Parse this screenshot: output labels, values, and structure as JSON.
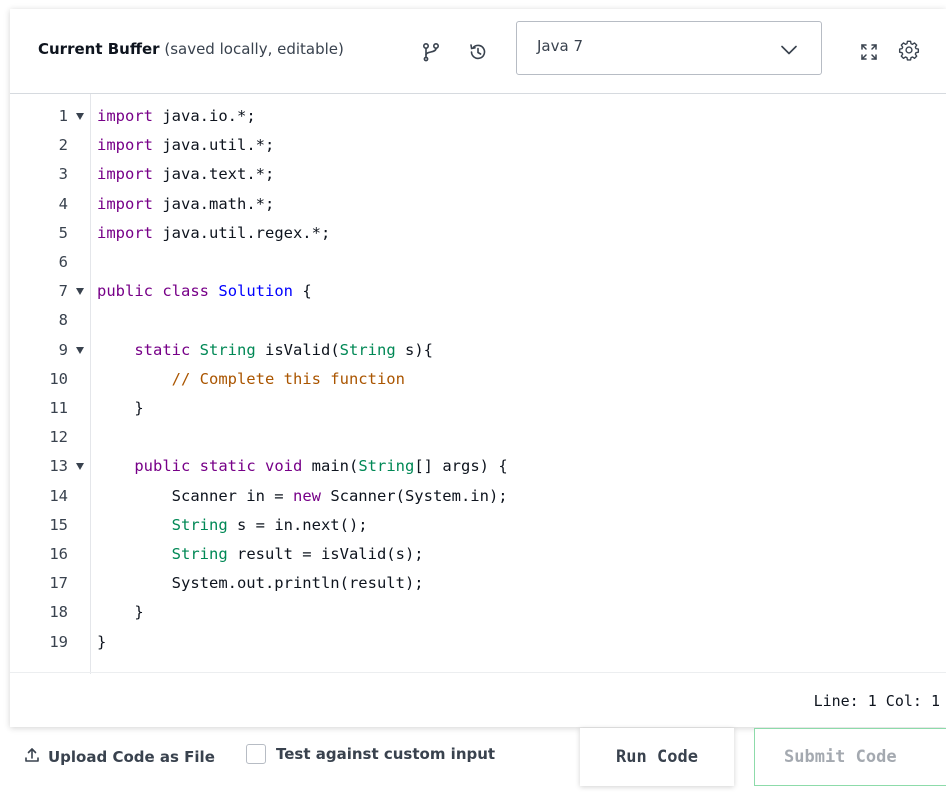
{
  "header": {
    "title_bold": "Current Buffer",
    "title_note": "(saved locally, editable)",
    "icons": [
      "branch-icon",
      "history-icon",
      "expand-icon",
      "settings-icon"
    ]
  },
  "language_select": {
    "value": "Java 7",
    "icon": "chevron-down-icon"
  },
  "editor": {
    "lines": [
      {
        "num": "1",
        "fold": true,
        "indent": "",
        "tokens": [
          {
            "t": "import",
            "c": "kw"
          },
          {
            "t": " java.io.*;",
            "c": ""
          }
        ]
      },
      {
        "num": "2",
        "fold": false,
        "indent": "",
        "tokens": [
          {
            "t": "import",
            "c": "kw"
          },
          {
            "t": " java.util.*;",
            "c": ""
          }
        ]
      },
      {
        "num": "3",
        "fold": false,
        "indent": "",
        "tokens": [
          {
            "t": "import",
            "c": "kw"
          },
          {
            "t": " java.text.*;",
            "c": ""
          }
        ]
      },
      {
        "num": "4",
        "fold": false,
        "indent": "",
        "tokens": [
          {
            "t": "import",
            "c": "kw"
          },
          {
            "t": " java.math.*;",
            "c": ""
          }
        ]
      },
      {
        "num": "5",
        "fold": false,
        "indent": "",
        "tokens": [
          {
            "t": "import",
            "c": "kw"
          },
          {
            "t": " java.util.regex.*;",
            "c": ""
          }
        ]
      },
      {
        "num": "6",
        "fold": false,
        "indent": "",
        "tokens": []
      },
      {
        "num": "7",
        "fold": true,
        "indent": "",
        "tokens": [
          {
            "t": "public",
            "c": "kw"
          },
          {
            "t": " ",
            "c": ""
          },
          {
            "t": "class",
            "c": "kw"
          },
          {
            "t": " ",
            "c": ""
          },
          {
            "t": "Solution",
            "c": "def"
          },
          {
            "t": " {",
            "c": ""
          }
        ]
      },
      {
        "num": "8",
        "fold": false,
        "indent": "",
        "tokens": []
      },
      {
        "num": "9",
        "fold": true,
        "indent": "    ",
        "tokens": [
          {
            "t": "static",
            "c": "kw"
          },
          {
            "t": " ",
            "c": ""
          },
          {
            "t": "String",
            "c": "typ"
          },
          {
            "t": " isValid(",
            "c": ""
          },
          {
            "t": "String",
            "c": "typ"
          },
          {
            "t": " s){",
            "c": ""
          }
        ]
      },
      {
        "num": "10",
        "fold": false,
        "indent": "        ",
        "tokens": [
          {
            "t": "// Complete this function",
            "c": "cmt"
          }
        ]
      },
      {
        "num": "11",
        "fold": false,
        "indent": "    ",
        "tokens": [
          {
            "t": "}",
            "c": ""
          }
        ]
      },
      {
        "num": "12",
        "fold": false,
        "indent": "",
        "tokens": []
      },
      {
        "num": "13",
        "fold": true,
        "indent": "    ",
        "tokens": [
          {
            "t": "public",
            "c": "kw"
          },
          {
            "t": " ",
            "c": ""
          },
          {
            "t": "static",
            "c": "kw"
          },
          {
            "t": " ",
            "c": ""
          },
          {
            "t": "void",
            "c": "kw"
          },
          {
            "t": " main(",
            "c": ""
          },
          {
            "t": "String",
            "c": "typ"
          },
          {
            "t": "[] args) {",
            "c": ""
          }
        ]
      },
      {
        "num": "14",
        "fold": false,
        "indent": "        ",
        "tokens": [
          {
            "t": "Scanner in = ",
            "c": ""
          },
          {
            "t": "new",
            "c": "kw"
          },
          {
            "t": " Scanner(System.in);",
            "c": ""
          }
        ]
      },
      {
        "num": "15",
        "fold": false,
        "indent": "        ",
        "tokens": [
          {
            "t": "String",
            "c": "typ"
          },
          {
            "t": " s = in.next();",
            "c": ""
          }
        ]
      },
      {
        "num": "16",
        "fold": false,
        "indent": "        ",
        "tokens": [
          {
            "t": "String",
            "c": "typ"
          },
          {
            "t": " result = isValid(s);",
            "c": ""
          }
        ]
      },
      {
        "num": "17",
        "fold": false,
        "indent": "        ",
        "tokens": [
          {
            "t": "System.out.println(result);",
            "c": ""
          }
        ]
      },
      {
        "num": "18",
        "fold": false,
        "indent": "    ",
        "tokens": [
          {
            "t": "}",
            "c": ""
          }
        ]
      },
      {
        "num": "19",
        "fold": false,
        "indent": "",
        "tokens": [
          {
            "t": "}",
            "c": ""
          }
        ]
      }
    ]
  },
  "status": {
    "position": "Line: 1 Col: 1"
  },
  "footer": {
    "upload_label": "Upload Code as File",
    "custom_input_label": "Test against custom input",
    "custom_input_checked": false,
    "run_label": "Run Code",
    "submit_label": "Submit Code"
  },
  "colors": {
    "keyword": "#770088",
    "type": "#008855",
    "definition": "#0000ff",
    "comment": "#aa5500",
    "submit_border": "#8ddbaa"
  }
}
